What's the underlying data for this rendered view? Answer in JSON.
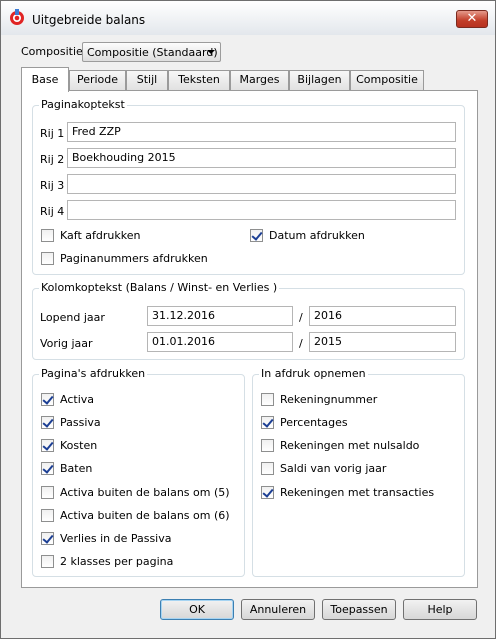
{
  "window": {
    "title": "Uitgebreide balans",
    "close_glyph": "✕"
  },
  "composition": {
    "label": "Compositie:",
    "value": "Compositie (Standaard)"
  },
  "tabs": [
    "Base",
    "Periode",
    "Stijl",
    "Teksten",
    "Marges",
    "Bijlagen",
    "Compositie"
  ],
  "active_tab": "Base",
  "page_header": {
    "title": "Paginakoptekst",
    "rows": [
      {
        "label": "Rij 1",
        "value": "Fred ZZP"
      },
      {
        "label": "Rij 2",
        "value": "Boekhouding 2015"
      },
      {
        "label": "Rij 3",
        "value": ""
      },
      {
        "label": "Rij 4",
        "value": ""
      }
    ],
    "checkboxes": [
      {
        "label": "Kaft afdrukken",
        "checked": false
      },
      {
        "label": "Datum afdrukken",
        "checked": true
      },
      {
        "label": "Paginanummers afdrukken",
        "checked": false
      }
    ]
  },
  "column_header": {
    "title": "Kolomkoptekst (Balans / Winst- en Verlies )",
    "separator": "/",
    "rows": [
      {
        "label": "Lopend jaar",
        "date": "31.12.2016",
        "year": "2016"
      },
      {
        "label": "Vorig jaar",
        "date": "01.01.2016",
        "year": "2015"
      }
    ]
  },
  "print_pages": {
    "title": "Pagina's afdrukken",
    "items": [
      {
        "label": "Activa",
        "checked": true
      },
      {
        "label": "Passiva",
        "checked": true
      },
      {
        "label": "Kosten",
        "checked": true
      },
      {
        "label": "Baten",
        "checked": true
      },
      {
        "label": "Activa buiten de balans om (5)",
        "checked": false
      },
      {
        "label": "Activa buiten de balans om (6)",
        "checked": false
      },
      {
        "label": "Verlies in de Passiva",
        "checked": true
      },
      {
        "label": "2 klasses per pagina",
        "checked": false
      }
    ]
  },
  "include": {
    "title": "In afdruk opnemen",
    "items": [
      {
        "label": "Rekeningnummer",
        "checked": false
      },
      {
        "label": "Percentages",
        "checked": true
      },
      {
        "label": "Rekeningen met nulsaldo",
        "checked": false
      },
      {
        "label": "Saldi van vorig jaar",
        "checked": false
      },
      {
        "label": "Rekeningen met transacties",
        "checked": true
      }
    ]
  },
  "buttons": {
    "ok": "OK",
    "cancel": "Annuleren",
    "apply": "Toepassen",
    "help": "Help"
  }
}
